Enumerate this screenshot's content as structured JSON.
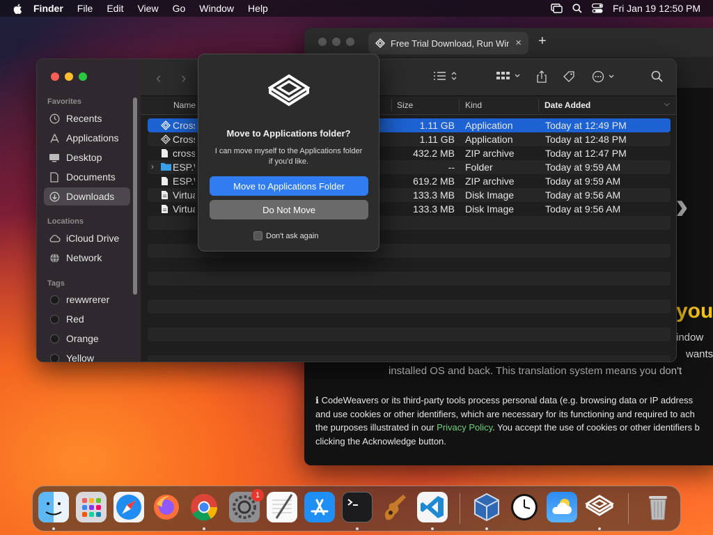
{
  "menubar": {
    "app_name": "Finder",
    "items": [
      "File",
      "Edit",
      "View",
      "Go",
      "Window",
      "Help"
    ],
    "clock": "Fri Jan 19  12:50 PM"
  },
  "browser": {
    "tab_title": "Free Trial Download, Run Win",
    "tab_close": "×",
    "new_tab": "+",
    "heading_fragment": "you",
    "text_line1": "indow",
    "text_line2": "wants t",
    "text_line3": "installed OS and back. This translation system means you don't",
    "notice_icon": "ℹ",
    "notice_part1": "CodeWeavers or its third-party tools process personal data (e.g. browsing data or IP address",
    "notice_part2": "and use cookies or other identifiers, which are necessary for its functioning and required to ach",
    "notice_part3": "the purposes illustrated in our ",
    "privacy_link": "Privacy Policy",
    "notice_part4": ". You accept the use of cookies or other identifiers b",
    "notice_part5": "clicking the Acknowledge button."
  },
  "finder": {
    "sidebar": {
      "favorites_header": "Favorites",
      "favorites": [
        {
          "label": "Recents",
          "icon": "clock-icon"
        },
        {
          "label": "Applications",
          "icon": "applications-icon"
        },
        {
          "label": "Desktop",
          "icon": "desktop-icon"
        },
        {
          "label": "Documents",
          "icon": "document-icon"
        },
        {
          "label": "Downloads",
          "icon": "downloads-icon",
          "selected": true
        }
      ],
      "locations_header": "Locations",
      "locations": [
        {
          "label": "iCloud Drive",
          "icon": "cloud-icon"
        },
        {
          "label": "Network",
          "icon": "globe-icon"
        }
      ],
      "tags_header": "Tags",
      "tags": [
        "rewwrerer",
        "Red",
        "Orange",
        "Yellow"
      ]
    },
    "columns": {
      "name": "Name",
      "size": "Size",
      "kind": "Kind",
      "date": "Date Added"
    },
    "files": [
      {
        "name": "Crossover",
        "size": "1.11 GB",
        "kind": "Application",
        "date": "Today at 12:49 PM",
        "icon": "crossover-app-icon",
        "selected": true
      },
      {
        "name": "Crossover",
        "size": "1.11 GB",
        "kind": "Application",
        "date": "Today at 12:48 PM",
        "icon": "crossover-app-icon"
      },
      {
        "name": "crossover",
        "size": "432.2 MB",
        "kind": "ZIP archive",
        "date": "Today at 12:47 PM",
        "icon": "file-icon"
      },
      {
        "name": "ESP.W",
        "size": "--",
        "kind": "Folder",
        "date": "Today at 9:59 AM",
        "icon": "folder-icon",
        "expandable": true
      },
      {
        "name": "ESP.W",
        "size": "619.2 MB",
        "kind": "ZIP archive",
        "date": "Today at 9:59 AM",
        "icon": "file-icon"
      },
      {
        "name": "Virtual",
        "size": "133.3 MB",
        "kind": "Disk Image",
        "date": "Today at 9:56 AM",
        "icon": "disk-image-icon"
      },
      {
        "name": "Virtual",
        "size": "133.3 MB",
        "kind": "Disk Image",
        "date": "Today at 9:56 AM",
        "icon": "disk-image-icon"
      }
    ]
  },
  "dialog": {
    "title": "Move to Applications folder?",
    "message": "I can move myself to the Applications folder if you'd like.",
    "primary_button": "Move to Applications Folder",
    "secondary_button": "Do Not Move",
    "checkbox_label": "Don't ask again"
  },
  "dock": {
    "apps": [
      "Finder",
      "Launchpad",
      "Safari",
      "Firefox",
      "Chrome",
      "System Settings",
      "TextEdit",
      "App Store",
      "Terminal",
      "GarageBand",
      "Visual Studio Code",
      "VirtualBox",
      "Clock",
      "Weather",
      "CrossOver",
      "Trash"
    ],
    "settings_badge": "1"
  }
}
